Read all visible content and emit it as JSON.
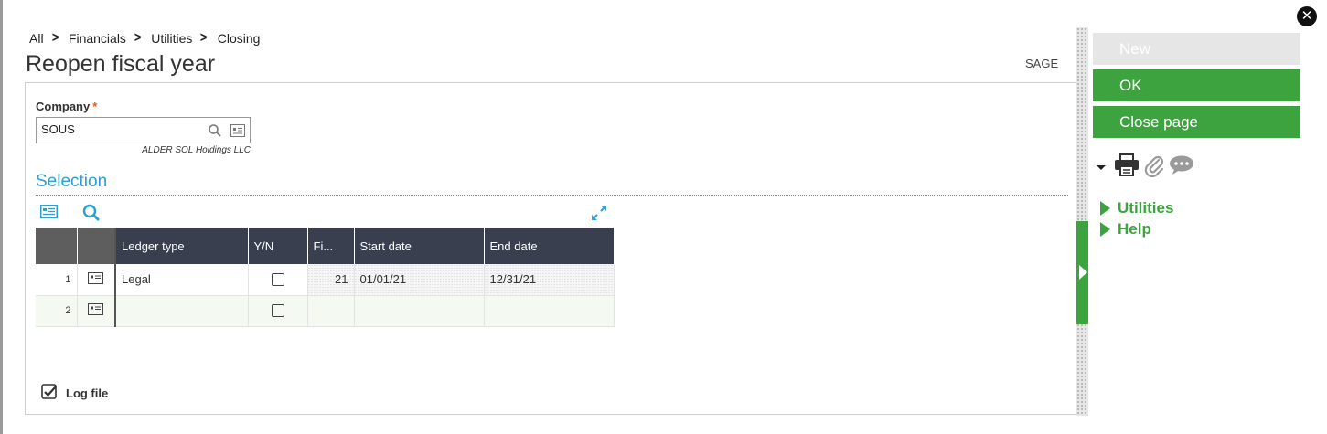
{
  "breadcrumb": {
    "items": [
      "All",
      "Financials",
      "Utilities",
      "Closing"
    ],
    "separator": ">"
  },
  "page": {
    "title": "Reopen fiscal year",
    "folder": "SAGE"
  },
  "company": {
    "label": "Company",
    "required_marker": "*",
    "value": "SOUS",
    "description": "ALDER SOL Holdings LLC"
  },
  "selection": {
    "title": "Selection",
    "columns": [
      "",
      "",
      "Ledger type",
      "Y/N",
      "Fi...",
      "Start date",
      "End date"
    ],
    "rows": [
      {
        "num": "1",
        "ledger_type": "Legal",
        "yn_checked": false,
        "fiscal": "21",
        "start_date": "01/01/21",
        "end_date": "12/31/21"
      },
      {
        "num": "2",
        "ledger_type": "",
        "yn_checked": false,
        "fiscal": "",
        "start_date": "",
        "end_date": ""
      }
    ]
  },
  "log_file": {
    "label": "Log file",
    "checked": true
  },
  "actions": {
    "new": "New",
    "ok": "OK",
    "close_page": "Close page"
  },
  "side_links": {
    "utilities": "Utilities",
    "help": "Help"
  },
  "colors": {
    "accent_green": "#3ca33f",
    "section_blue": "#2e9fd0",
    "grid_header": "#3a3f4f",
    "required": "#e05a1c"
  }
}
